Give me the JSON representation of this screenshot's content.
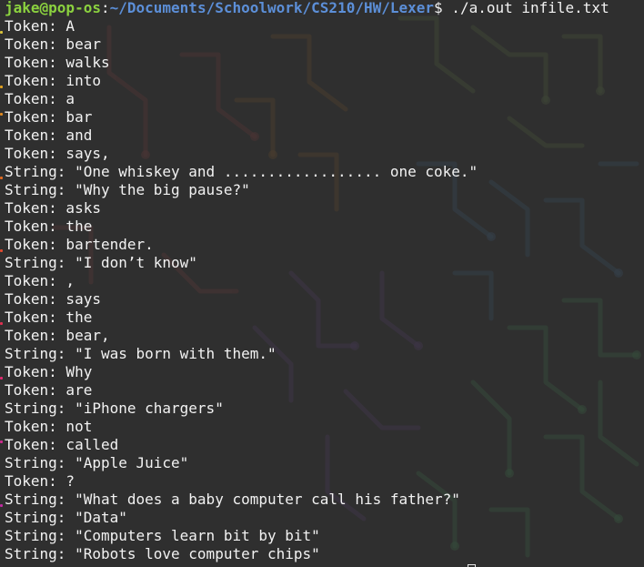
{
  "prompt": {
    "user_host": "jake@pop-os",
    "separator": ":",
    "path": "~/Documents/Schoolwork/CS210/HW/Lexer",
    "dollar": "$",
    "command": " ./a.out infile.txt"
  },
  "output_lines": [
    "Token: A",
    "Token: bear",
    "Token: walks",
    "Token: into",
    "Token: a",
    "Token: bar",
    "Token: and",
    "Token: says,",
    "String: \"One whiskey and .................. one coke.\"",
    "String: \"Why the big pause?\"",
    "Token: asks",
    "Token: the",
    "Token: bartender.",
    "String: \"I don’t know\"",
    "Token: ,",
    "Token: says",
    "Token: the",
    "Token: bear,",
    "String: \"I was born with them.\"",
    "Token: Why",
    "Token: are",
    "String: \"iPhone chargers\"",
    "Token: not",
    "Token: called",
    "String: \"Apple Juice\"",
    "Token: ?",
    "String: \"What does a baby computer call his father?\"",
    "String: \"Data\"",
    "String: \"Computers learn bit by bit\"",
    "String: \"Robots love computer chips\""
  ],
  "colors": {
    "background": "#2f2f2f",
    "text": "#f2f2f2",
    "prompt_user": "#8bd13f",
    "prompt_path": "#5c8fd8"
  }
}
